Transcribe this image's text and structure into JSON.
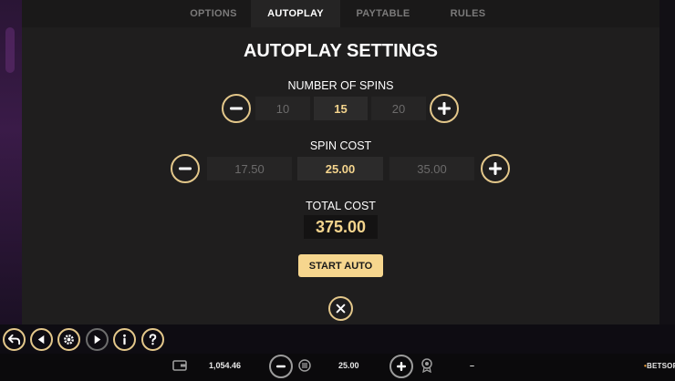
{
  "tabs": [
    {
      "label": "OPTIONS"
    },
    {
      "label": "AUTOPLAY"
    },
    {
      "label": "PAYTABLE"
    },
    {
      "label": "RULES"
    }
  ],
  "active_tab": "AUTOPLAY",
  "title": "AUTOPLAY SETTINGS",
  "spins": {
    "label": "NUMBER OF SPINS",
    "options": [
      "10",
      "15",
      "20"
    ],
    "selected": "15"
  },
  "spin_cost": {
    "label": "SPIN COST",
    "options": [
      "17.50",
      "25.00",
      "35.00"
    ],
    "selected": "25.00"
  },
  "total": {
    "label": "TOTAL COST",
    "value": "375.00"
  },
  "start_button": "START AUTO",
  "bottom": {
    "balance": "1,054.46",
    "bet": "25.00",
    "win": "–",
    "brand_prefix": "•",
    "brand": "BETSOFT"
  },
  "colors": {
    "accent": "#f4d48d",
    "button": "#f6d68e",
    "panel": "#1f1e1e"
  },
  "icons": [
    "minus-icon",
    "plus-icon",
    "close-icon",
    "back-icon",
    "play-back-icon",
    "gear-icon",
    "play-icon",
    "info-icon",
    "help-icon",
    "wallet-icon",
    "coins-icon",
    "award-icon"
  ]
}
